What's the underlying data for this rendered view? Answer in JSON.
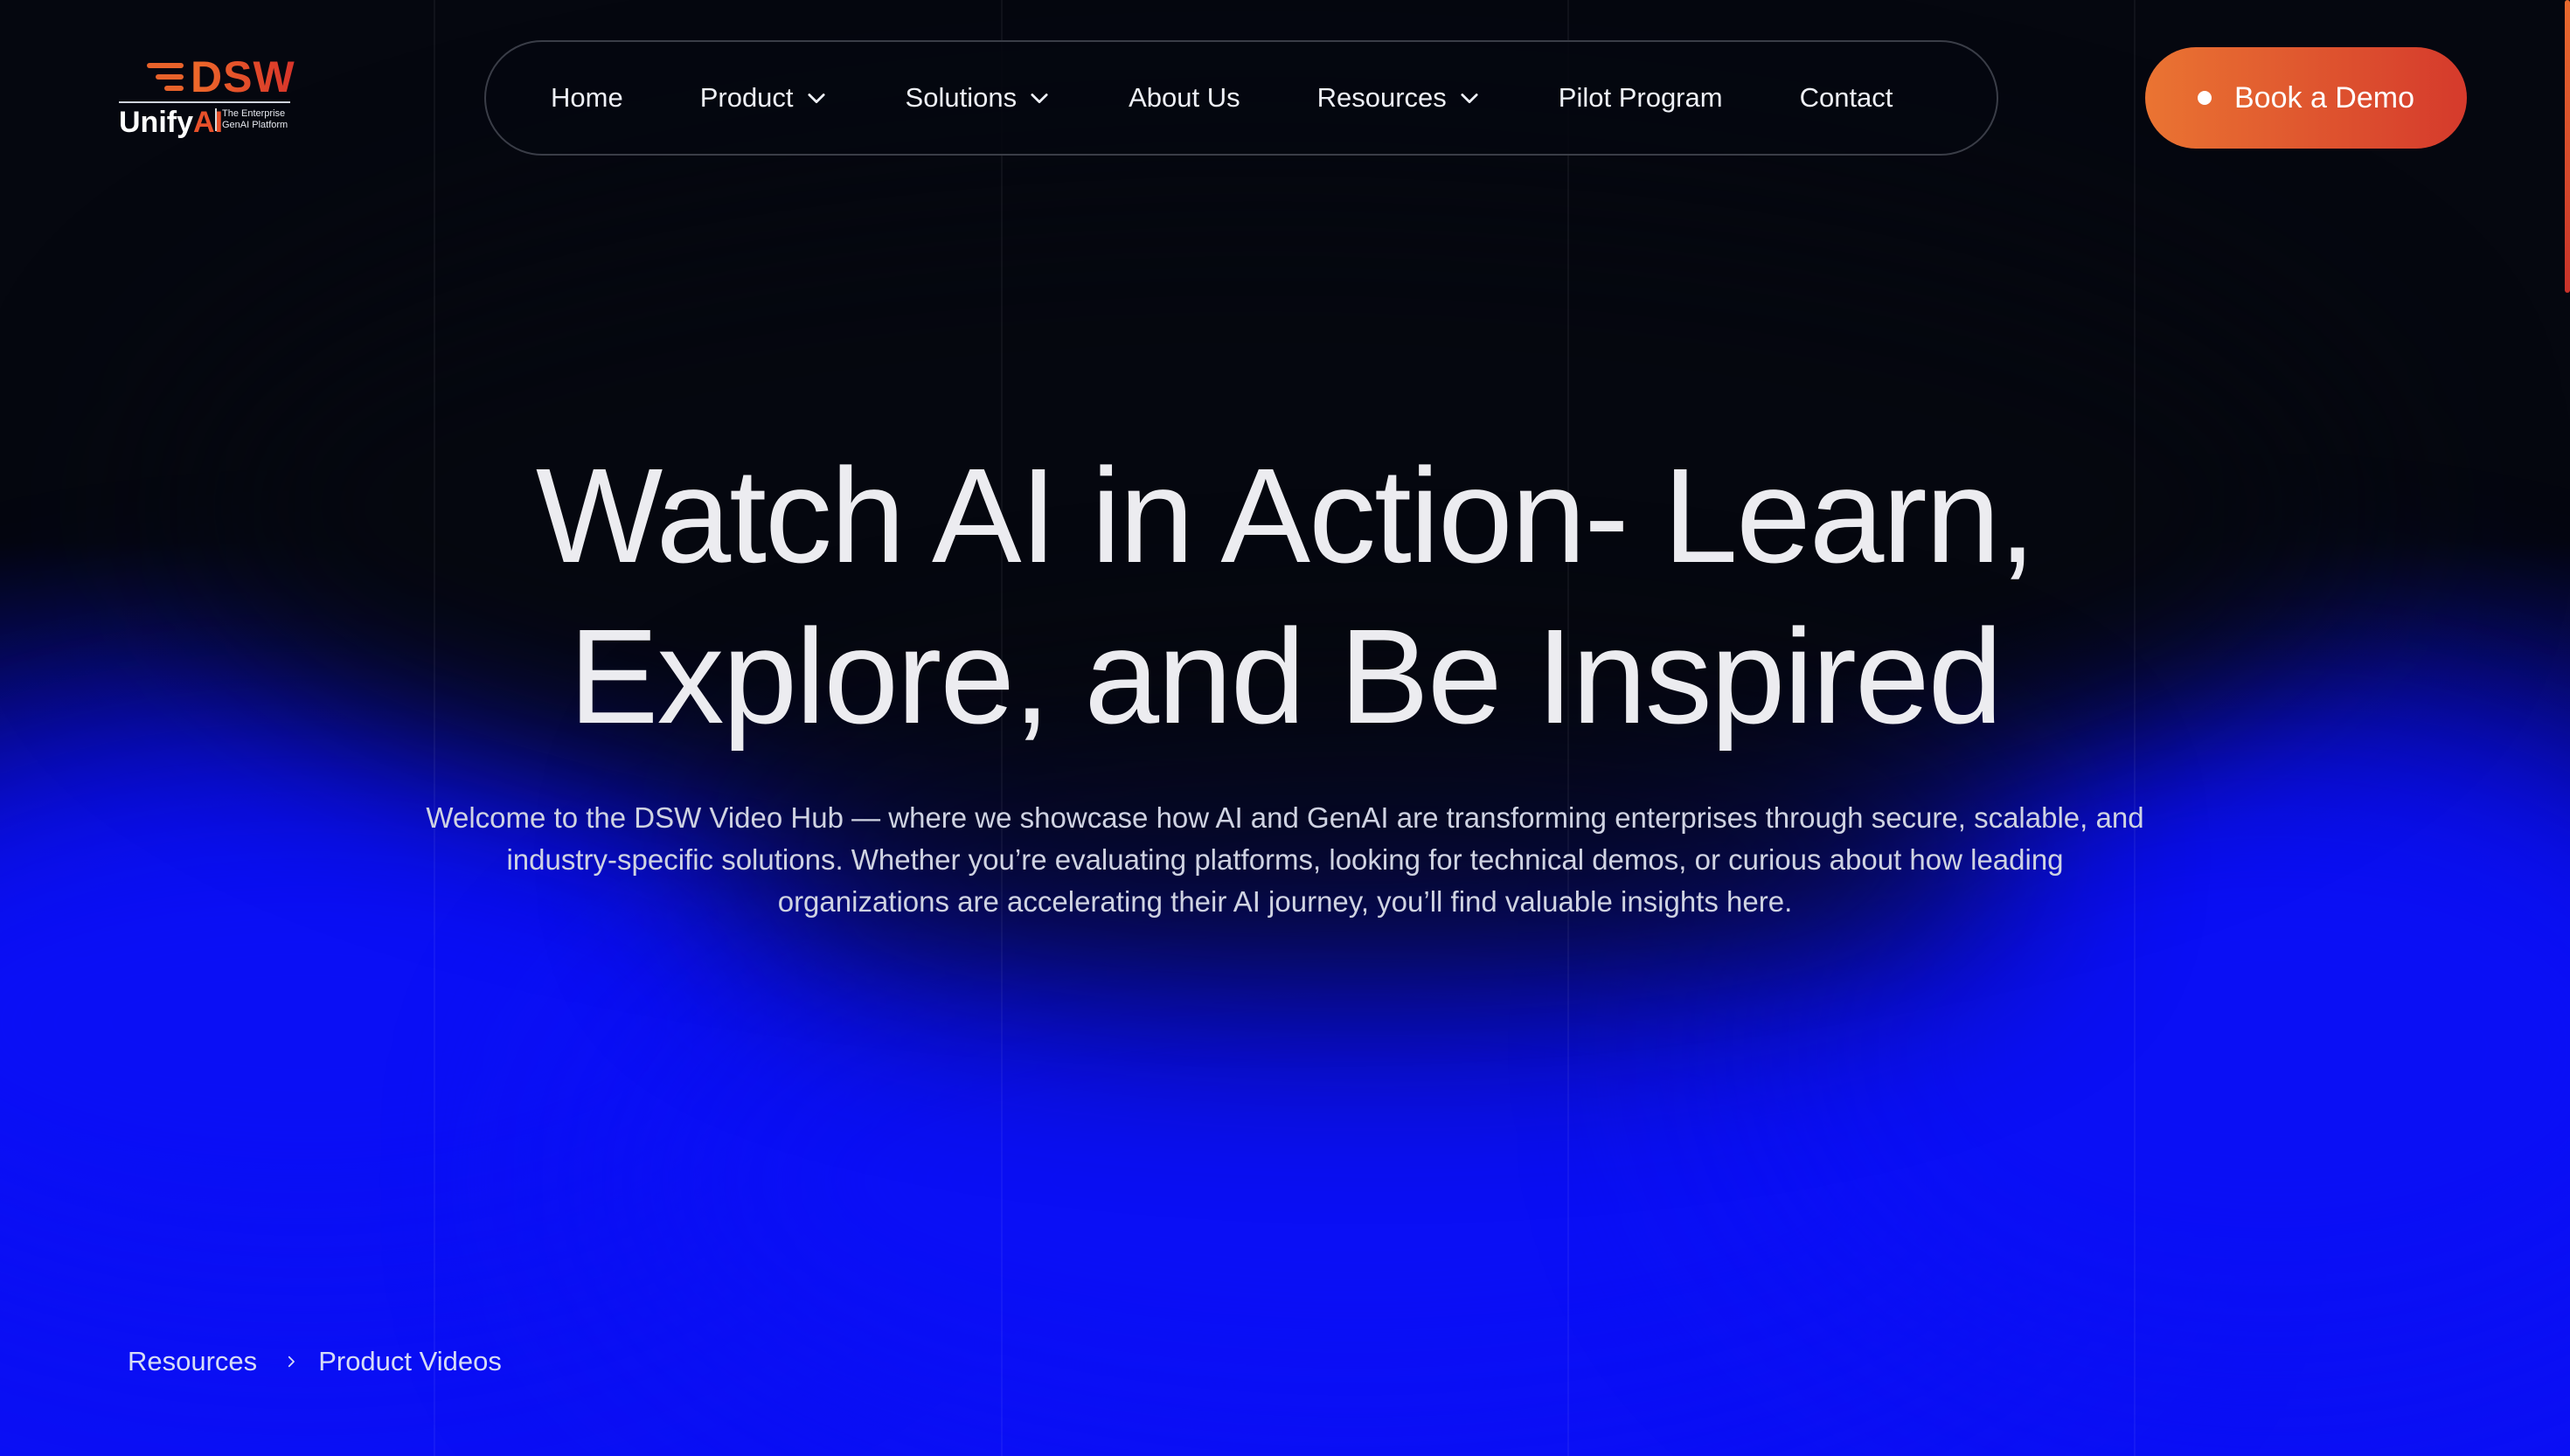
{
  "brand": {
    "logo_primary": "DSW",
    "logo_secondary_a": "Unify",
    "logo_secondary_b": "AI",
    "tagline_line1": "The Enterprise",
    "tagline_line2": "GenAI Platform"
  },
  "nav": {
    "items": [
      {
        "label": "Home",
        "has_menu": false
      },
      {
        "label": "Product",
        "has_menu": true
      },
      {
        "label": "Solutions",
        "has_menu": true
      },
      {
        "label": "About Us",
        "has_menu": false
      },
      {
        "label": "Resources",
        "has_menu": true
      },
      {
        "label": "Pilot Program",
        "has_menu": false
      },
      {
        "label": "Contact",
        "has_menu": false
      }
    ]
  },
  "cta": {
    "label": "Book a Demo"
  },
  "hero": {
    "title_line1": "Watch AI in Action- Learn,",
    "title_line2": "Explore, and Be Inspired",
    "subtitle_line1": "Welcome to the DSW Video Hub — where we showcase how AI and GenAI are transforming enterprises through secure, scalable, and",
    "subtitle_line2": "industry-specific solutions. Whether you’re evaluating platforms, looking for technical demos, or curious about how leading",
    "subtitle_line3": "organizations are accelerating their AI journey, you’ll find valuable insights here."
  },
  "breadcrumb": {
    "items": [
      "Resources",
      "Product Videos"
    ]
  },
  "colors": {
    "background": "#05070f",
    "glow_blue": "#0a0ff5",
    "accent_orange": "#ea7432",
    "accent_red": "#d53a2c"
  },
  "icons": {
    "menu_chevron": "chevron-down-icon",
    "breadcrumb_separator": "chevron-right-icon",
    "cta_dot": "dot-icon"
  }
}
